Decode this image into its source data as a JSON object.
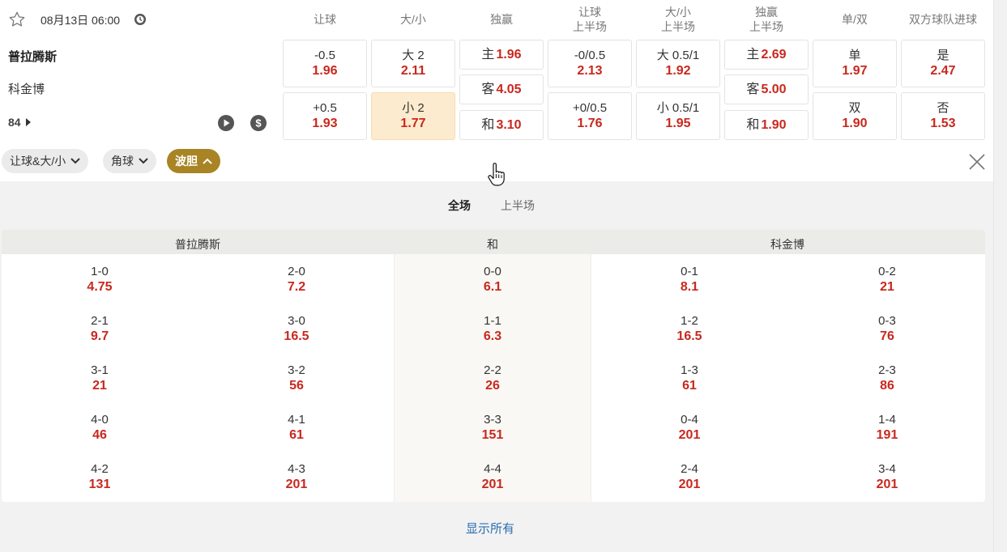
{
  "match": {
    "date_time": "08月13日 06:00",
    "home": "普拉腾斯",
    "away": "科金博",
    "minute": "84"
  },
  "markets": {
    "headers": [
      [
        "让球"
      ],
      [
        "大/小"
      ],
      [
        "独赢"
      ],
      [
        "让球",
        "上半场"
      ],
      [
        "大/小",
        "上半场"
      ],
      [
        "独赢",
        "上半场"
      ],
      [
        "单/双"
      ],
      [
        "双方球队进球"
      ]
    ],
    "handicap": [
      {
        "label": "-0.5",
        "odd": "1.96"
      },
      {
        "label": "+0.5",
        "odd": "1.93"
      }
    ],
    "over_under": [
      {
        "label": "大 2",
        "odd": "2.11"
      },
      {
        "label": "小 2",
        "odd": "1.77",
        "selected": true
      }
    ],
    "moneyline": [
      {
        "label": "主",
        "odd": "1.96"
      },
      {
        "label": "客",
        "odd": "4.05"
      },
      {
        "label": "和",
        "odd": "3.10"
      }
    ],
    "handicap_1h": [
      {
        "label": "-0/0.5",
        "odd": "2.13"
      },
      {
        "label": "+0/0.5",
        "odd": "1.76"
      }
    ],
    "over_under_1h": [
      {
        "label": "大 0.5/1",
        "odd": "1.92"
      },
      {
        "label": "小 0.5/1",
        "odd": "1.95"
      }
    ],
    "moneyline_1h": [
      {
        "label": "主",
        "odd": "2.69"
      },
      {
        "label": "客",
        "odd": "5.00"
      },
      {
        "label": "和",
        "odd": "1.90"
      }
    ],
    "odd_even": [
      {
        "label": "单",
        "odd": "1.97"
      },
      {
        "label": "双",
        "odd": "1.90"
      }
    ],
    "btts": [
      {
        "label": "是",
        "odd": "2.47"
      },
      {
        "label": "否",
        "odd": "1.53"
      }
    ]
  },
  "filters": [
    {
      "label": "让球&大/小",
      "active": false
    },
    {
      "label": "角球",
      "active": false
    },
    {
      "label": "波胆",
      "active": true
    }
  ],
  "correct_score": {
    "tabs": [
      "全场",
      "上半场"
    ],
    "active_tab": "全场",
    "group_headers": [
      "普拉腾斯",
      "和",
      "科金博"
    ],
    "columns": [
      [
        {
          "s": "1-0",
          "o": "4.75"
        },
        {
          "s": "2-1",
          "o": "9.7"
        },
        {
          "s": "3-1",
          "o": "21"
        },
        {
          "s": "4-0",
          "o": "46"
        },
        {
          "s": "4-2",
          "o": "131"
        }
      ],
      [
        {
          "s": "2-0",
          "o": "7.2"
        },
        {
          "s": "3-0",
          "o": "16.5"
        },
        {
          "s": "3-2",
          "o": "56"
        },
        {
          "s": "4-1",
          "o": "61"
        },
        {
          "s": "4-3",
          "o": "201"
        }
      ],
      [
        {
          "s": "0-0",
          "o": "6.1"
        },
        {
          "s": "1-1",
          "o": "6.3"
        },
        {
          "s": "2-2",
          "o": "26"
        },
        {
          "s": "3-3",
          "o": "151"
        },
        {
          "s": "4-4",
          "o": "201"
        }
      ],
      [
        {
          "s": "0-1",
          "o": "8.1"
        },
        {
          "s": "1-2",
          "o": "16.5"
        },
        {
          "s": "1-3",
          "o": "61"
        },
        {
          "s": "0-4",
          "o": "201"
        },
        {
          "s": "2-4",
          "o": "201"
        }
      ],
      [
        {
          "s": "0-2",
          "o": "21"
        },
        {
          "s": "0-3",
          "o": "76"
        },
        {
          "s": "2-3",
          "o": "86"
        },
        {
          "s": "1-4",
          "o": "191"
        },
        {
          "s": "3-4",
          "o": "201"
        }
      ]
    ],
    "show_all": "显示所有"
  },
  "colors": {
    "odd_red": "#c8281e",
    "selected_bg": "#fcebce",
    "active_chip": "#a88424",
    "link_blue": "#2a6db0"
  },
  "icons": [
    "star-icon",
    "clock-icon",
    "play-icon",
    "dollar-icon",
    "chevron-down-icon",
    "chevron-up-icon",
    "close-icon",
    "hand-cursor-icon"
  ]
}
